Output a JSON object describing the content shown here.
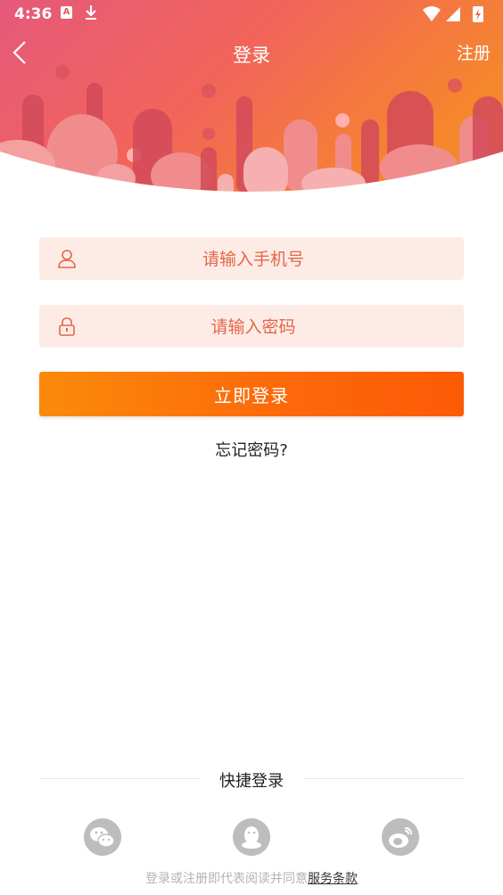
{
  "status_bar": {
    "time": "4:36",
    "notification_icons": [
      "a-letter-icon",
      "download-icon"
    ],
    "system_icons": [
      "wifi-icon",
      "signal-icon",
      "battery-charging-icon"
    ]
  },
  "nav": {
    "title": "登录",
    "register_label": "注册"
  },
  "form": {
    "phone_placeholder": "请输入手机号",
    "password_placeholder": "请输入密码",
    "login_button": "立即登录",
    "forgot_password": "忘记密码?"
  },
  "quick_login": {
    "label": "快捷登录",
    "options": [
      "wechat-icon",
      "qq-icon",
      "weibo-icon"
    ]
  },
  "terms": {
    "text": "登录或注册即代表阅读并同意",
    "link": "服务条款"
  },
  "colors": {
    "accent_orange": "#fc6a0a",
    "field_bg": "#fdece6",
    "field_text": "#e4664a",
    "header_gradient_start": "#e55476",
    "header_gradient_end": "#f58a2a"
  }
}
